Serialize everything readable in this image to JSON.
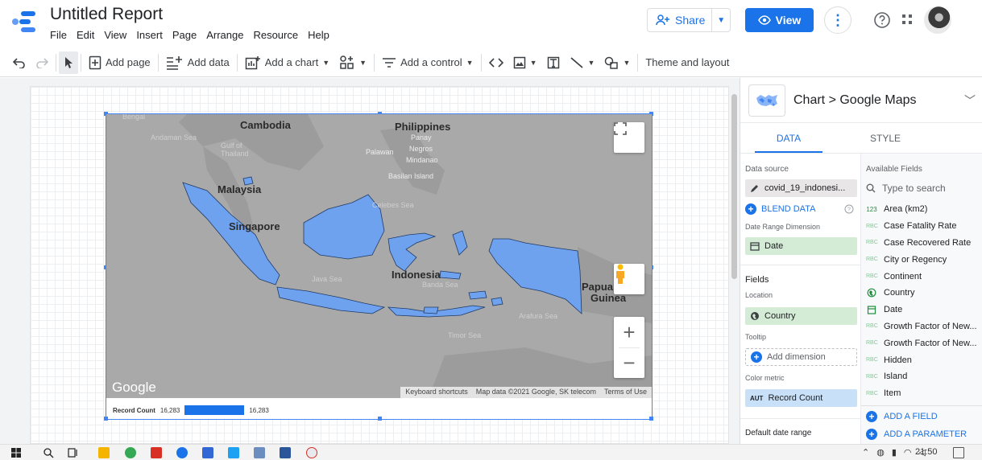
{
  "app": {
    "title": "Untitled Report",
    "menu": [
      "File",
      "Edit",
      "View",
      "Insert",
      "Page",
      "Arrange",
      "Resource",
      "Help"
    ],
    "share_label": "Share",
    "view_label": "View",
    "accent_color": "#1a73e8"
  },
  "toolbar": {
    "add_page": "Add page",
    "add_data": "Add data",
    "add_chart": "Add a chart",
    "add_control": "Add a control",
    "theme_layout": "Theme and layout"
  },
  "map": {
    "labels": {
      "cambodia": "Cambodia",
      "philippines": "Philippines",
      "panay": "Panay",
      "negros": "Negros",
      "palawan": "Palawan",
      "mindanao": "Mindanao",
      "basilan": "Basilan Island",
      "malaysia": "Malaysia",
      "singapore": "Singapore",
      "indonesia": "Indonesia",
      "papua": "Papua",
      "guinea": "Guinea",
      "andaman_sea": "Andaman Sea",
      "gulf_thailand_1": "Gulf of",
      "gulf_thailand_2": "Thailand",
      "celebes_sea": "Celebes Sea",
      "java_sea": "Java Sea",
      "banda_sea": "Banda Sea",
      "arafura_sea": "Arafura Sea",
      "timor_sea": "Timor Sea",
      "bengal": "Bengal"
    },
    "google_logo": "Google",
    "attribution": {
      "shortcuts": "Keyboard shortcuts",
      "map_data": "Map data ©2021 Google, SK telecom",
      "terms": "Terms of Use"
    },
    "zoom_in": "+",
    "zoom_out": "−",
    "fill_color": "#6fa2ee",
    "legend": {
      "label": "Record Count",
      "min": "16,283",
      "max": "16,283"
    }
  },
  "panel": {
    "title": "Chart > Google Maps",
    "tabs": [
      "DATA",
      "STYLE"
    ],
    "active_tab": "DATA",
    "data_source_label": "Data source",
    "data_source": "covid_19_indonesi...",
    "blend_data": "BLEND DATA",
    "date_range_dimension_label": "Date Range Dimension",
    "date_range_dimension": "Date",
    "fields_label": "Fields",
    "location_label": "Location",
    "location": "Country",
    "tooltip_label": "Tooltip",
    "add_dimension": "Add dimension",
    "color_metric_label": "Color metric",
    "color_metric_type": "AUT",
    "color_metric": "Record Count",
    "default_date_range_label": "Default date range",
    "available_fields_label": "Available Fields",
    "search_placeholder": "Type to search",
    "available_fields": [
      {
        "type": "123",
        "name": "Area (km2)"
      },
      {
        "type": "RBC",
        "name": "Case Fatality Rate"
      },
      {
        "type": "RBC",
        "name": "Case Recovered Rate"
      },
      {
        "type": "RBC",
        "name": "City or Regency"
      },
      {
        "type": "RBC",
        "name": "Continent"
      },
      {
        "type": "globe",
        "name": "Country"
      },
      {
        "type": "date",
        "name": "Date"
      },
      {
        "type": "RBC",
        "name": "Growth Factor of New..."
      },
      {
        "type": "RBC",
        "name": "Growth Factor of New..."
      },
      {
        "type": "RBC",
        "name": "Hidden"
      },
      {
        "type": "RBC",
        "name": "Island"
      },
      {
        "type": "RBC",
        "name": "Item"
      }
    ],
    "add_field": "ADD A FIELD",
    "add_parameter": "ADD A PARAMETER"
  },
  "taskbar": {
    "time": "21:50"
  }
}
